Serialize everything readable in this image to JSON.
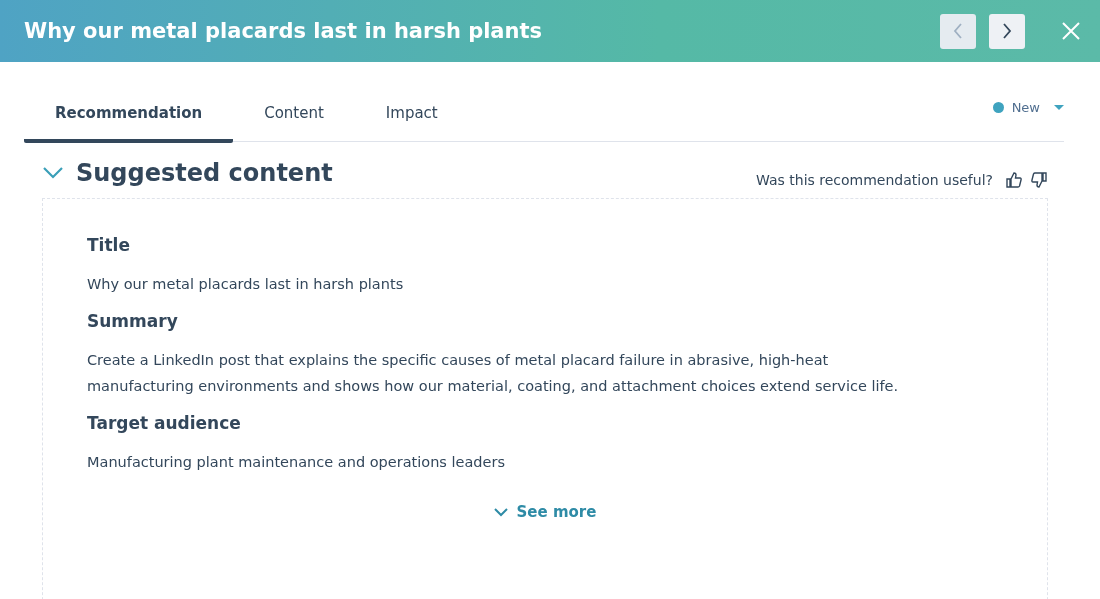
{
  "header": {
    "title": "Why our metal placards last in harsh plants",
    "nav_buttons": [
      {
        "kind": "prev",
        "disabled": true
      },
      {
        "kind": "next",
        "disabled": false
      }
    ]
  },
  "tabs": [
    {
      "label": "Recommendation",
      "selected": true
    },
    {
      "label": "Content",
      "selected": false
    },
    {
      "label": "Impact",
      "selected": false
    }
  ],
  "status": {
    "label": "New",
    "color": "#3fa3bf"
  },
  "section": {
    "title": "Suggested content",
    "expanded": true,
    "feedback_question": "Was this recommendation useful?"
  },
  "fields": [
    {
      "label": "Title",
      "value": "Why our metal placards last in harsh plants"
    },
    {
      "label": "Summary",
      "value": "Create a LinkedIn post that explains the specific causes of metal placard failure in abrasive, high-heat manufacturing environments and shows how our material, coating, and attachment choices extend service life."
    },
    {
      "label": "Target audience",
      "value": "Manufacturing plant maintenance and operations leaders"
    }
  ],
  "see_more": "See more"
}
